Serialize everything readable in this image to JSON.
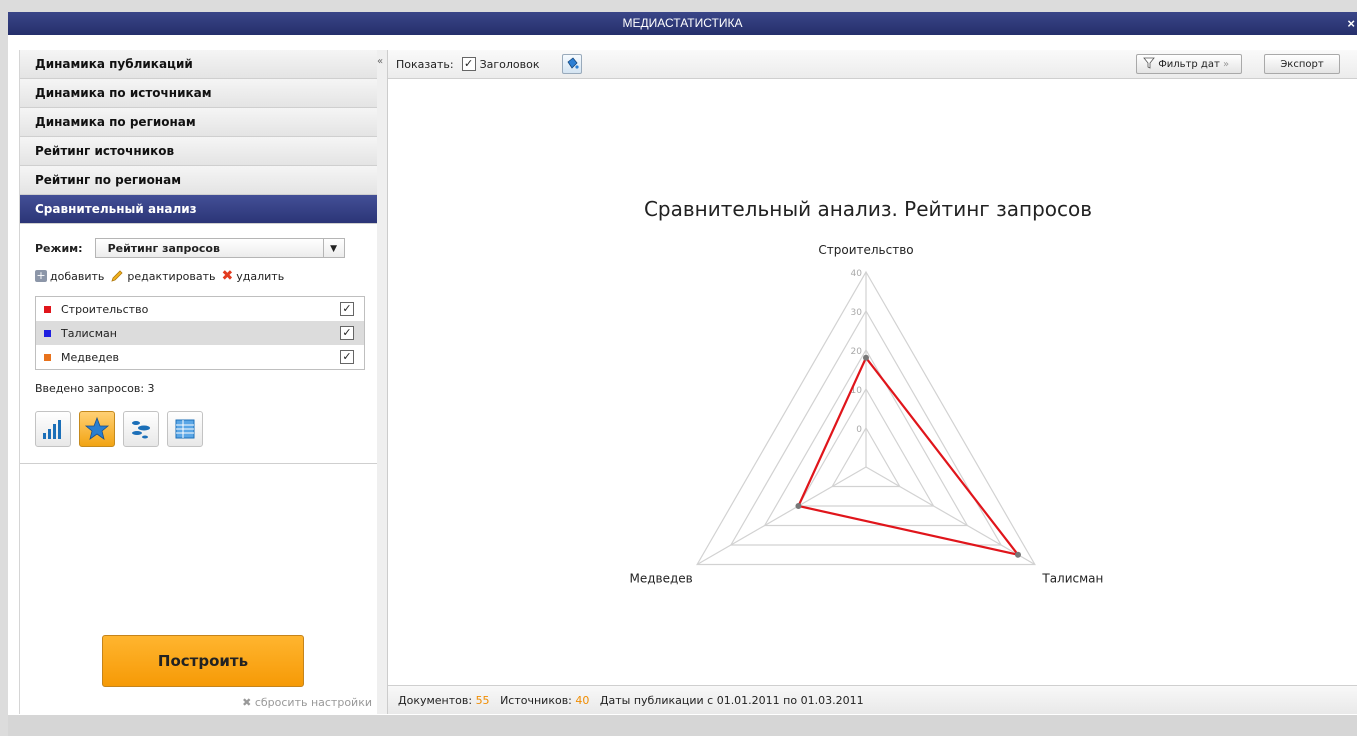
{
  "window": {
    "title": "МЕДИАСТАТИСТИКА",
    "close": "×"
  },
  "sidebar": {
    "items": [
      {
        "label": "Динамика публикаций"
      },
      {
        "label": "Динамика по источникам"
      },
      {
        "label": "Динамика по регионам"
      },
      {
        "label": "Рейтинг источников"
      },
      {
        "label": "Рейтинг по регионам"
      },
      {
        "label": "Сравнительный анализ"
      }
    ],
    "mode_label": "Режим:",
    "mode_value": "Рейтинг запросов",
    "add_label": "добавить",
    "edit_label": "редактировать",
    "delete_label": "удалить",
    "queries": [
      {
        "name": "Строительство",
        "color": "#e0151b",
        "checked": true
      },
      {
        "name": "Талисман",
        "color": "#1f1fe0",
        "checked": true
      },
      {
        "name": "Медведев",
        "color": "#e8721c",
        "checked": true
      }
    ],
    "entered_label": "Введено запросов: 3",
    "chart_types": [
      "bar-chart-icon",
      "star-chart-icon",
      "bubble-chart-icon",
      "table-icon"
    ],
    "build_label": "Построить",
    "reset_label": "сбросить настройки"
  },
  "toolbar": {
    "show_label": "Показать:",
    "title_checkbox_label": "Заголовок",
    "date_filter_label": "Фильтр дат",
    "export_label": "Экспорт"
  },
  "chart_data": {
    "type": "radar",
    "title": "Сравнительный анализ. Рейтинг запросов",
    "axes": [
      "Строительство",
      "Талисман",
      "Медведев"
    ],
    "rlim": [
      -10,
      40
    ],
    "ticks": [
      0,
      10,
      20,
      30,
      40
    ],
    "series": [
      {
        "values": [
          18,
          35,
          10
        ],
        "color": "#e0151b"
      }
    ],
    "grid": true
  },
  "status": {
    "docs_label": "Документов:",
    "docs_value": "55",
    "sources_label": "Источников:",
    "sources_value": "40",
    "dates_text": "Даты публикации с 01.01.2011 по 01.03.2011"
  }
}
